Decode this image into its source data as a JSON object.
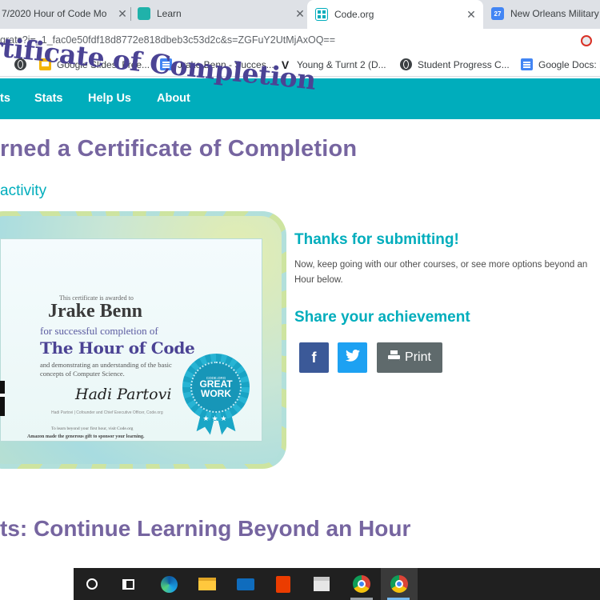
{
  "browser": {
    "tabs": [
      {
        "title": "7/2020 Hour of Code Mo",
        "close": "✕",
        "active": false,
        "fav_color": "#9aa0a6"
      },
      {
        "title": "Learn",
        "close": "✕",
        "active": false,
        "fav_color": "#20b2aa"
      },
      {
        "title": "Code.org",
        "close": "✕",
        "active": true,
        "fav_color": "#00adbc"
      },
      {
        "title": "New Orleans Military",
        "active": false,
        "fav_color": "#4285f4",
        "fav_text": "27"
      }
    ],
    "url": "grats?i=_1_fac0e50fdf18d8772e818dbeb3c53d2c&s=ZGFuY2UtMjAxOQ==",
    "bookmarks": [
      {
        "label": "",
        "icon": "globe-icon"
      },
      {
        "label": "Google Slides: Free...",
        "icon": "slides-icon"
      },
      {
        "label": "Jrake Benn - Succes...",
        "icon": "doc-icon"
      },
      {
        "label": "Young & Turnt 2 (D...",
        "icon": "v-icon",
        "glyph": "V"
      },
      {
        "label": "Student Progress C...",
        "icon": "globe-icon"
      },
      {
        "label": "Google Docs: F",
        "icon": "doc-icon"
      }
    ]
  },
  "site_nav": {
    "items": [
      "ts",
      "Stats",
      "Help Us",
      "About"
    ]
  },
  "page": {
    "heading": "rned a Certificate of Completion",
    "subheading": "activity",
    "certificate": {
      "title": "rtificate of Completion",
      "awarded_text": "This certificate is awarded to",
      "name": "Jrake Benn",
      "success_text": "for successful completion of",
      "course": "The Hour of Code",
      "demonstrating_text": "and demonstrating an understanding of the basic concepts of Computer Science.",
      "signature": "Hadi Partovi",
      "signer": "Hadi Partovi | Cofounder and Chief Executive Officer, Code.org",
      "learn_more": "To learn beyond your first hour, visit Code.org",
      "sponsor": "Amazon made the generous gift to sponsor your learning.",
      "badge": {
        "top": "CODE.ORG",
        "line1": "GREAT",
        "line2": "WORK",
        "stars": "★★★"
      }
    },
    "thanks_title": "Thanks for submitting!",
    "thanks_text": "Now, keep going with our other courses, or see more options beyond an Hour below.",
    "share_title": "Share your achievement",
    "share_buttons": {
      "facebook": "f",
      "print": "Print"
    },
    "bottom_heading": "ts: Continue Learning Beyond an Hour"
  },
  "colors": {
    "brand_teal": "#00adbc",
    "heading_purple": "#7665a0",
    "facebook": "#3b5998",
    "twitter": "#1da1f2",
    "print_gray": "#5f6a6c"
  }
}
